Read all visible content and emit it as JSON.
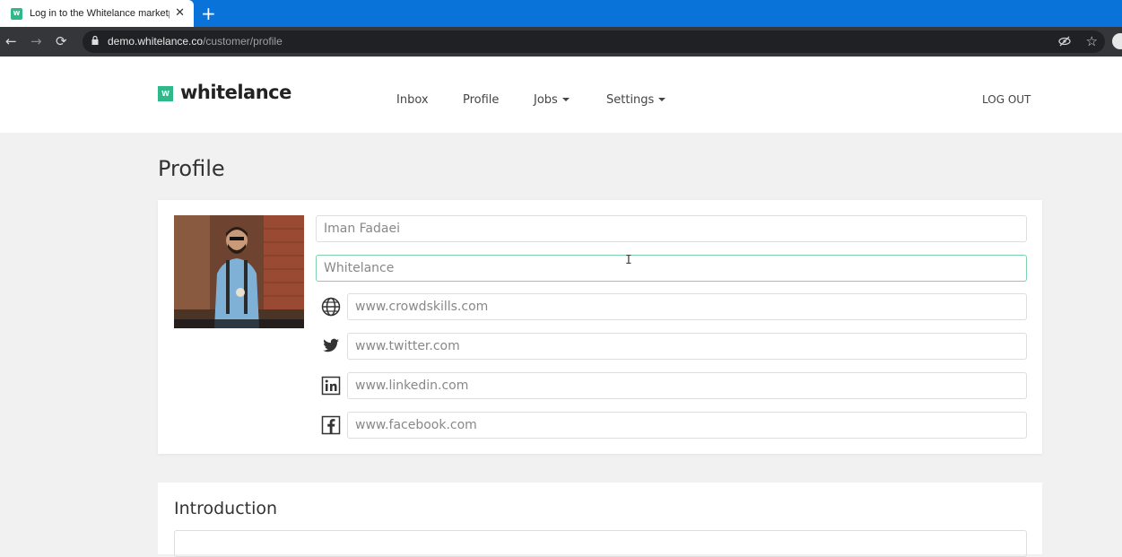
{
  "browser": {
    "tab_title": "Log in to the Whitelance marketp",
    "favicon_letter": "W",
    "url_host": "demo.whitelance.co",
    "url_path": "/customer/profile",
    "new_tab": "+",
    "close": "✕",
    "back": "←",
    "forward": "→",
    "reload": "⟳",
    "star": "☆"
  },
  "header": {
    "logo_letter": "W",
    "logo_text": "whitelance",
    "nav": {
      "inbox": "Inbox",
      "profile": "Profile",
      "jobs": "Jobs",
      "settings": "Settings"
    },
    "logout": "LOG OUT"
  },
  "page": {
    "title": "Profile"
  },
  "profile_form": {
    "name": "Iman Fadaei",
    "company": "Whitelance",
    "website": "www.crowdskills.com",
    "twitter": "www.twitter.com",
    "linkedin": "www.linkedin.com",
    "facebook": "www.facebook.com"
  },
  "introduction": {
    "title": "Introduction"
  },
  "colors": {
    "accent": "#2fb88a",
    "chrome_blue": "#0a73d9",
    "focus_border": "#7fd1ad"
  }
}
